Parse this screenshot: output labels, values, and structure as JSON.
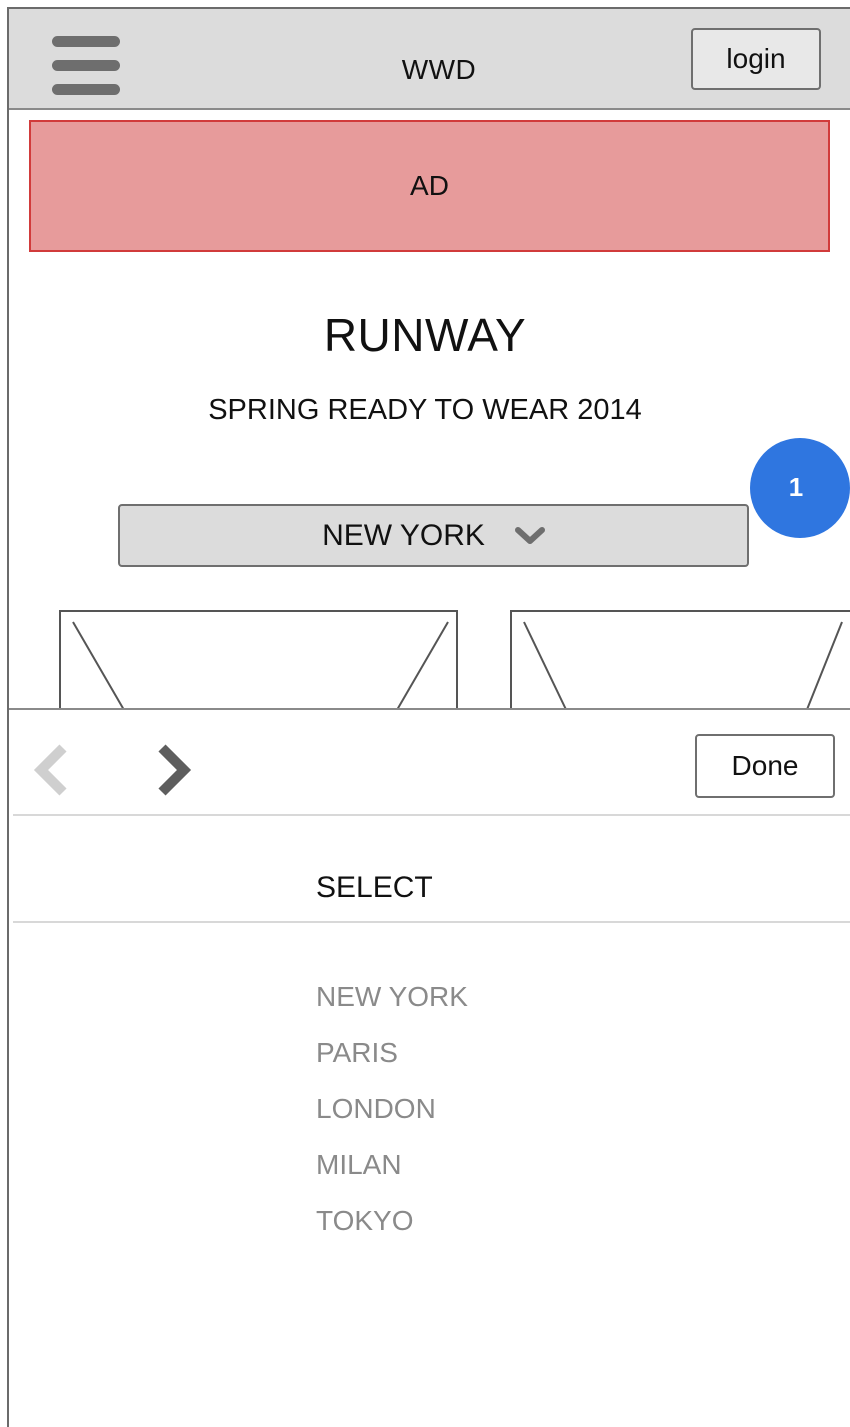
{
  "header": {
    "site_title": "WWD",
    "login_label": "login"
  },
  "ad": {
    "label": "AD"
  },
  "page": {
    "title": "RUNWAY",
    "subtitle": "SPRING READY TO WEAR 2014",
    "city_dropdown": {
      "selected": "NEW YORK"
    },
    "badge_number": "1"
  },
  "picker": {
    "done_label": "Done",
    "header": "SELECT",
    "options": [
      "NEW YORK",
      "PARIS",
      "LONDON",
      "MILAN",
      "TOKYO"
    ]
  },
  "colors": {
    "header_bg": "#dcdcdc",
    "ad_bg": "#e79b9b",
    "ad_border": "#d13b3b",
    "badge": "#2f76e0",
    "option_text": "#8a8a8a"
  },
  "icons": {
    "menu": "hamburger-icon",
    "dropdown": "chevron-down-icon",
    "prev": "chevron-left-icon",
    "next": "chevron-right-icon"
  }
}
